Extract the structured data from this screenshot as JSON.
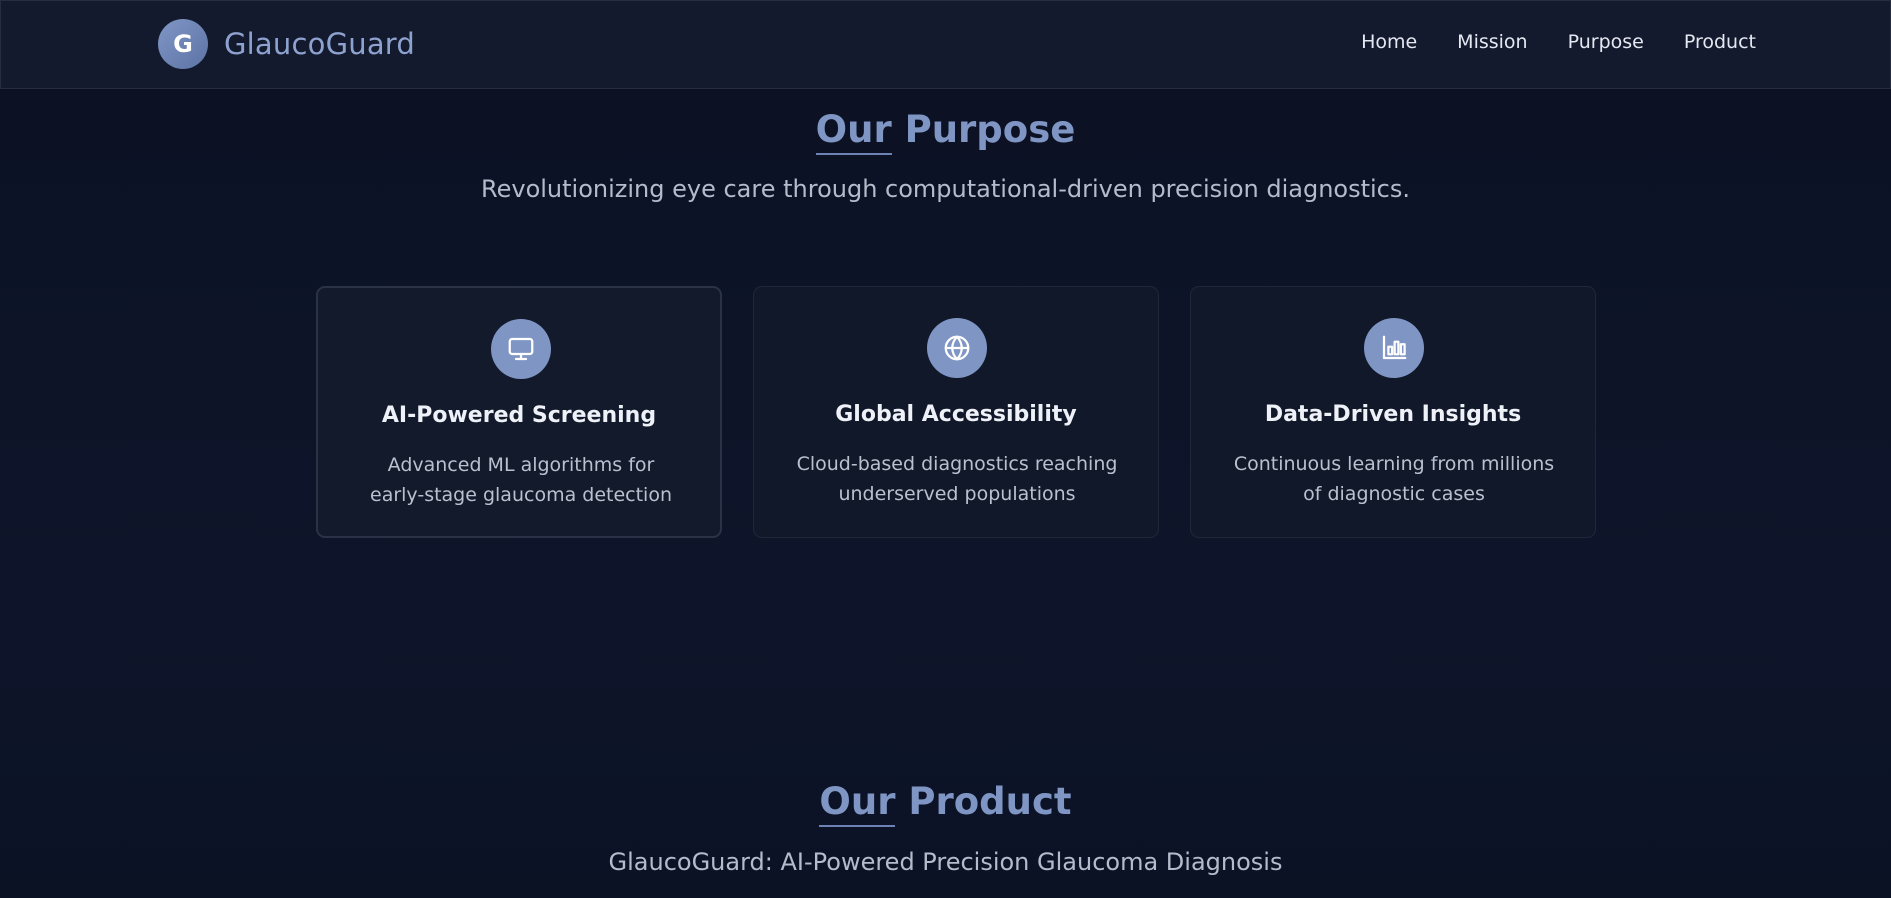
{
  "nav": {
    "logo_letter": "G",
    "brand": "GlaucoGuard",
    "links": [
      "Home",
      "Mission",
      "Purpose",
      "Product"
    ]
  },
  "purpose": {
    "title_underlined": "Our",
    "title_rest": "Purpose",
    "subtitle": "Revolutionizing eye care through computational-driven precision diagnostics.",
    "cards": [
      {
        "icon": "monitor-icon",
        "title": "AI-Powered Screening",
        "desc": "Advanced ML algorithms for early-stage glaucoma detection"
      },
      {
        "icon": "globe-icon",
        "title": "Global Accessibility",
        "desc": "Cloud-based diagnostics reaching underserved populations"
      },
      {
        "icon": "bar-chart-icon",
        "title": "Data-Driven Insights",
        "desc": "Continuous learning from millions of diagnostic cases"
      }
    ]
  },
  "product": {
    "title_underlined": "Our",
    "title_rest": "Product",
    "subtitle": "GlaucoGuard: AI-Powered Precision Glaucoma Diagnosis"
  },
  "colors": {
    "accent": "#7f95c4",
    "background": "#0d1428",
    "navbar": "#141a2d"
  }
}
